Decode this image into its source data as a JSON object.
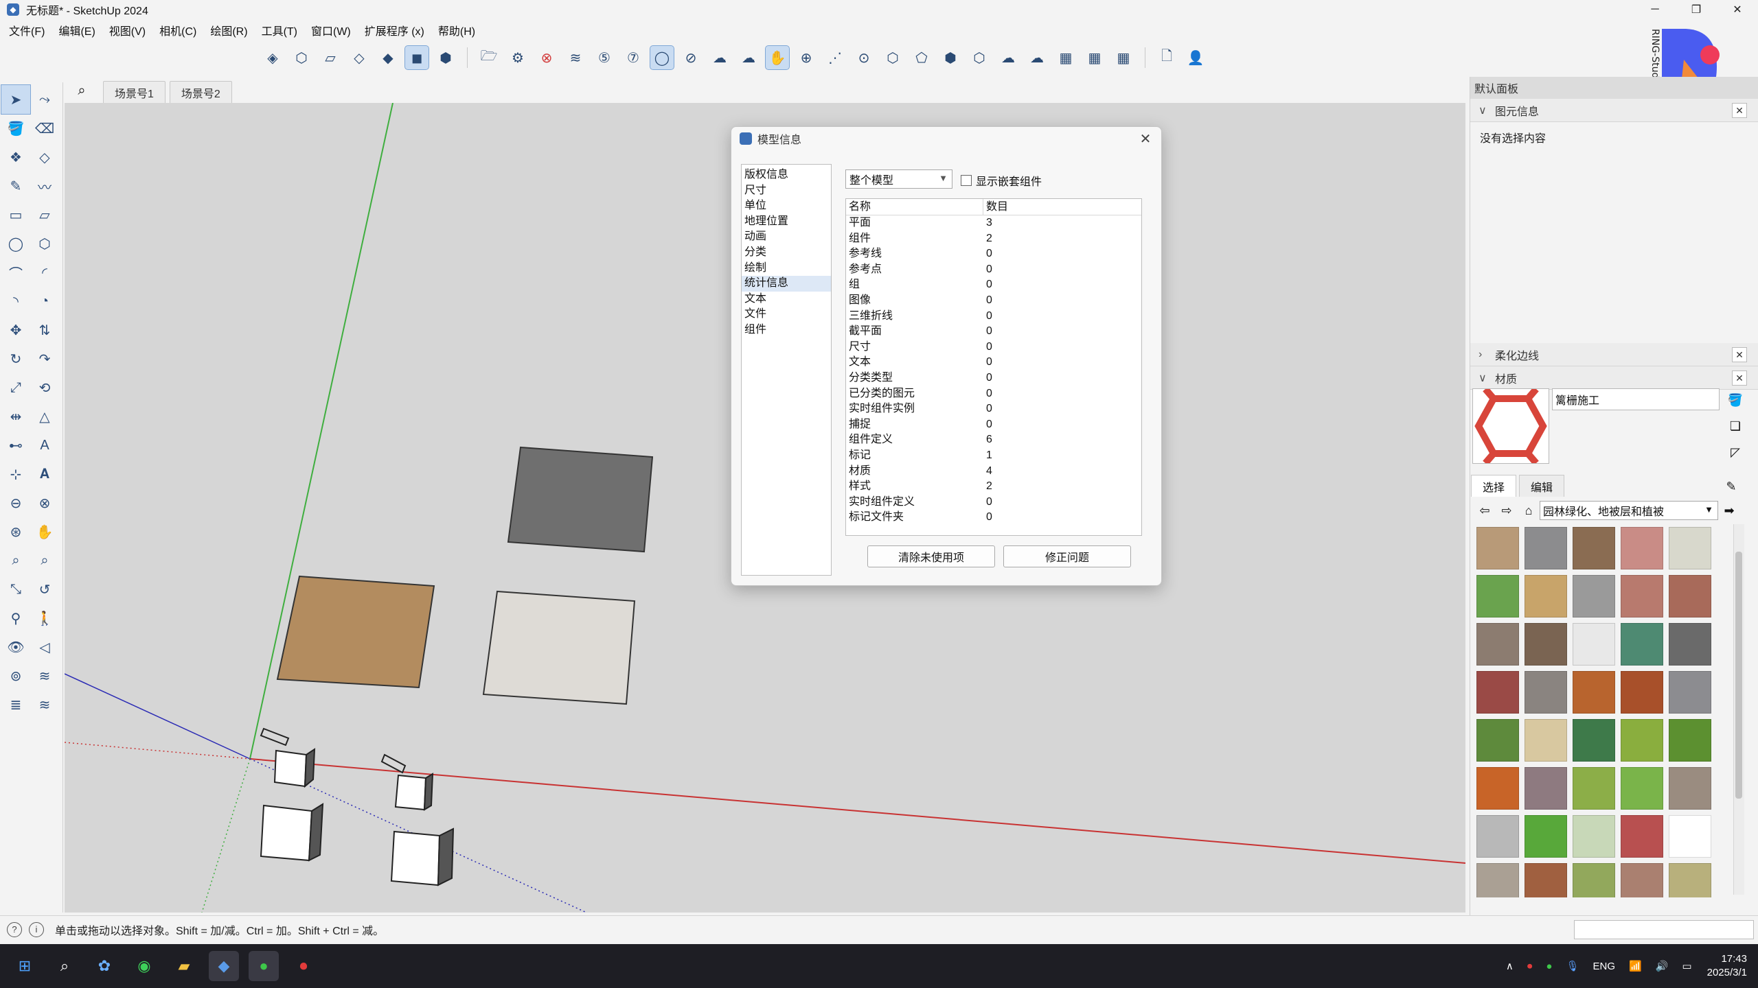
{
  "window": {
    "title": "无标题* - SketchUp 2024",
    "controls": [
      "─",
      "❐",
      "✕"
    ]
  },
  "menu": [
    "文件(F)",
    "编辑(E)",
    "视图(V)",
    "相机(C)",
    "绘图(R)",
    "工具(T)",
    "窗口(W)",
    "扩展程序 (x)",
    "帮助(H)"
  ],
  "scenes": {
    "tabs": [
      "场景号1",
      "场景号2"
    ]
  },
  "dialog": {
    "title": "模型信息",
    "nav": [
      "版权信息",
      "尺寸",
      "单位",
      "地理位置",
      "动画",
      "分类",
      "绘制",
      "统计信息",
      "文本",
      "文件",
      "组件"
    ],
    "selected_nav": "统计信息",
    "scope_select": "整个模型",
    "nested_checkbox_label": "显示嵌套组件",
    "table_headers": {
      "name": "名称",
      "count": "数目"
    },
    "stats": [
      {
        "name": "平面",
        "count": "3"
      },
      {
        "name": "组件",
        "count": "2"
      },
      {
        "name": "参考线",
        "count": "0"
      },
      {
        "name": "参考点",
        "count": "0"
      },
      {
        "name": "组",
        "count": "0"
      },
      {
        "name": "图像",
        "count": "0"
      },
      {
        "name": "三维折线",
        "count": "0"
      },
      {
        "name": "截平面",
        "count": "0"
      },
      {
        "name": "尺寸",
        "count": "0"
      },
      {
        "name": "文本",
        "count": "0"
      },
      {
        "name": "分类类型",
        "count": "0"
      },
      {
        "name": "已分类的图元",
        "count": "0"
      },
      {
        "name": "实时组件实例",
        "count": "0"
      },
      {
        "name": "捕捉",
        "count": "0"
      },
      {
        "name": "组件定义",
        "count": "6"
      },
      {
        "name": "标记",
        "count": "1"
      },
      {
        "name": "材质",
        "count": "4"
      },
      {
        "name": "样式",
        "count": "2"
      },
      {
        "name": "实时组件定义",
        "count": "0"
      },
      {
        "name": "标记文件夹",
        "count": "0"
      }
    ],
    "purge_button": "清除未使用项",
    "fix_button": "修正问题"
  },
  "right_panel": {
    "header": "默认面板",
    "entity_info_label": "图元信息",
    "entity_info_body": "没有选择内容",
    "soften_label": "柔化边线",
    "materials_label": "材质",
    "material_name": "篱栅施工",
    "tab_select": "选择",
    "tab_edit": "编辑",
    "library": "园林绿化、地被层和植被",
    "logo_text": "RING-Studio",
    "swatches": [
      "#b89a78",
      "#8c8c8e",
      "#8a6c52",
      "#c98c86",
      "#d8d8cc",
      "#6aa34e",
      "#c8a46a",
      "#9a9a9a",
      "#b87a6e",
      "#a86a5a",
      "#8c7c70",
      "#7a6452",
      "#e8e8e8",
      "#4e8a72",
      "#6a6a6a",
      "#9a4a46",
      "#8a8480",
      "#b8642e",
      "#a8502a",
      "#8c8c90",
      "#5e8a3c",
      "#d8c8a0",
      "#3e7a4a",
      "#8aae3e",
      "#5c9030",
      "#c86428",
      "#8e7a80",
      "#8cae48",
      "#7ab44a",
      "#9a8c80",
      "#b8b8b8",
      "#58a83a",
      "#c8d8b8",
      "#b85050",
      "#ffffff",
      "#aaa094",
      "#a06040",
      "#92a85c",
      "#aa8070",
      "#b8b07c"
    ]
  },
  "status": {
    "hint": "单击或拖动以选择对象。Shift = 加/减。Ctrl = 加。Shift + Ctrl = 减。"
  },
  "taskbar": {
    "lang": "ENG",
    "time": "17:43",
    "date": "2025/3/1"
  }
}
